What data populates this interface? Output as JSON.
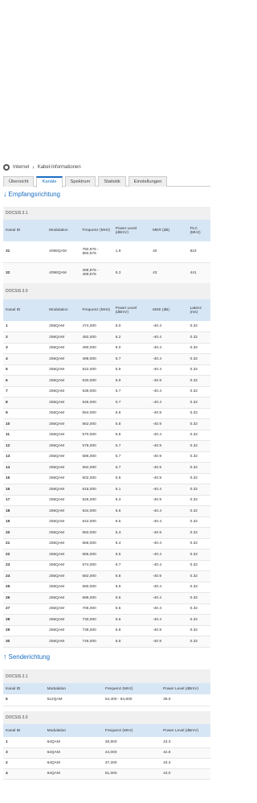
{
  "breadcrumb": {
    "items": [
      "Internet",
      "Kabel-Informationen"
    ]
  },
  "tabs": [
    "Übersicht",
    "Kanäle",
    "Spektrum",
    "Statistik",
    "Einstellungen"
  ],
  "downstream": {
    "heading": "Empfangsrichtung",
    "docsis31": {
      "title": "DOCSIS 3.1",
      "headers": [
        "Kanal ID",
        "Modulation",
        "Frequenz (MHz)",
        "Power Level (dBmV)",
        "MER (dB)",
        "PLC (MHz)"
      ],
      "rows": [
        [
          "31",
          "4096QAM",
          "750,975 - 860,975",
          "1.9",
          "40",
          "823"
        ],
        [
          "32",
          "4096QAM",
          "398,975 - 469,975",
          "5.3",
          "43",
          "441"
        ]
      ]
    },
    "docsis30": {
      "title": "DOCSIS 3.0",
      "headers": [
        "Kanal ID",
        "Modulation",
        "Frequenz (MHz)",
        "Power Level (dBmV)",
        "MSE (dB)",
        "Latenz (ms)"
      ],
      "rows": [
        [
          "1",
          "256QAM",
          "474,000",
          "6.0",
          "-40.4",
          "0.32"
        ],
        [
          "2",
          "256QAM",
          "482,000",
          "6.2",
          "-40.4",
          "0.32"
        ],
        [
          "3",
          "256QAM",
          "490,000",
          "6.0",
          "-40.4",
          "0.32"
        ],
        [
          "4",
          "256QAM",
          "498,000",
          "5.7",
          "-40.4",
          "0.32"
        ],
        [
          "5",
          "256QAM",
          "522,000",
          "5.9",
          "-40.4",
          "0.32"
        ],
        [
          "6",
          "256QAM",
          "530,000",
          "5.9",
          "-40.9",
          "0.32"
        ],
        [
          "7",
          "256QAM",
          "538,000",
          "5.7",
          "-40.4",
          "0.32"
        ],
        [
          "8",
          "256QAM",
          "546,000",
          "5.7",
          "-40.4",
          "0.32"
        ],
        [
          "9",
          "256QAM",
          "554,000",
          "5.6",
          "-40.9",
          "0.32"
        ],
        [
          "10",
          "256QAM",
          "562,000",
          "5.8",
          "-40.9",
          "0.32"
        ],
        [
          "11",
          "256QAM",
          "570,000",
          "5.8",
          "-40.4",
          "0.32"
        ],
        [
          "12",
          "256QAM",
          "578,000",
          "5.7",
          "-40.9",
          "0.32"
        ],
        [
          "13",
          "256QAM",
          "586,000",
          "5.7",
          "-40.9",
          "0.32"
        ],
        [
          "14",
          "256QAM",
          "594,000",
          "5.7",
          "-40.9",
          "0.32"
        ],
        [
          "15",
          "256QAM",
          "602,000",
          "5.5",
          "-40.9",
          "0.32"
        ],
        [
          "16",
          "256QAM",
          "618,000",
          "6.1",
          "-40.4",
          "0.32"
        ],
        [
          "17",
          "256QAM",
          "626,000",
          "6.3",
          "-40.9",
          "0.32"
        ],
        [
          "18",
          "256QAM",
          "634,000",
          "6.6",
          "-40.4",
          "0.32"
        ],
        [
          "19",
          "256QAM",
          "642,000",
          "6.5",
          "-40.4",
          "0.32"
        ],
        [
          "20",
          "256QAM",
          "650,000",
          "6.3",
          "-40.9",
          "0.32"
        ],
        [
          "21",
          "256QAM",
          "658,000",
          "6.4",
          "-40.4",
          "0.32"
        ],
        [
          "22",
          "256QAM",
          "666,000",
          "6.5",
          "-40.4",
          "0.32"
        ],
        [
          "23",
          "256QAM",
          "674,000",
          "6.7",
          "-40.4",
          "0.32"
        ],
        [
          "24",
          "256QAM",
          "682,000",
          "6.8",
          "-40.9",
          "0.32"
        ],
        [
          "25",
          "256QAM",
          "690,000",
          "6.9",
          "-40.4",
          "0.32"
        ],
        [
          "26",
          "256QAM",
          "698,000",
          "6.6",
          "-40.4",
          "0.32"
        ],
        [
          "27",
          "256QAM",
          "706,000",
          "6.5",
          "-40.4",
          "0.32"
        ],
        [
          "28",
          "256QAM",
          "730,000",
          "6.6",
          "-40.4",
          "0.32"
        ],
        [
          "29",
          "256QAM",
          "738,000",
          "6.8",
          "-40.9",
          "0.32"
        ],
        [
          "30",
          "256QAM",
          "746,000",
          "6.8",
          "-40.9",
          "0.32"
        ]
      ]
    }
  },
  "upstream": {
    "heading": "Senderichtung",
    "docsis31": {
      "title": "DOCSIS 3.1",
      "headers": [
        "Kanal ID",
        "Modulation",
        "Frequenz (MHz)",
        "Power Level (dBmV)"
      ],
      "rows": [
        [
          "5",
          "512QAM",
          "54,400 - 64,800",
          "39.0"
        ]
      ]
    },
    "docsis30": {
      "title": "DOCSIS 3.0",
      "headers": [
        "Kanal ID",
        "Modulation",
        "Frequenz (MHz)",
        "Power Level (dBmV)"
      ],
      "rows": [
        [
          "1",
          "64QAM",
          "30,800",
          "43.3"
        ],
        [
          "3",
          "64QAM",
          "44,000",
          "42.8"
        ],
        [
          "2",
          "64QAM",
          "37,200",
          "43.3"
        ],
        [
          "4",
          "64QAM",
          "51,000",
          "43.0"
        ]
      ]
    }
  }
}
